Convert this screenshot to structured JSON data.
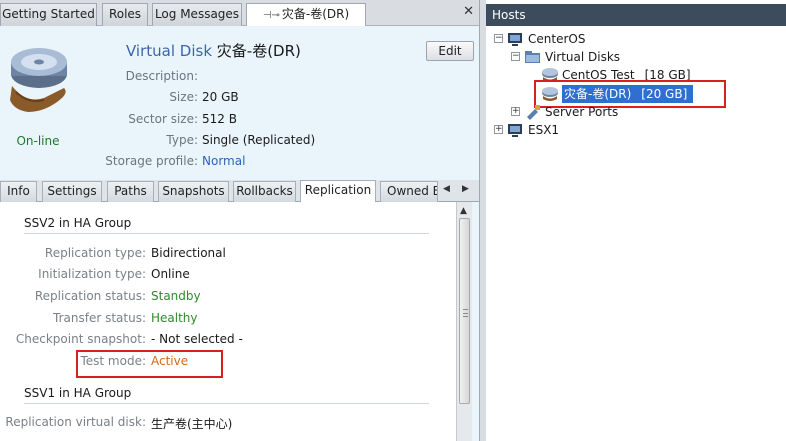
{
  "doc_tabs": [
    {
      "label": "Getting Started"
    },
    {
      "label": "Roles"
    },
    {
      "label": "Log Messages"
    },
    {
      "label": "灾备-卷(DR)",
      "active": true,
      "pinned": true
    }
  ],
  "header": {
    "kind": "Virtual Disk",
    "name": "灾备-卷(DR)",
    "edit_label": "Edit",
    "status": "On-line",
    "props": [
      {
        "label": "Description:",
        "value": ""
      },
      {
        "label": "Size:",
        "value": "20 GB"
      },
      {
        "label": "Sector size:",
        "value": "512 B"
      },
      {
        "label": "Type:",
        "value": "Single (Replicated)"
      },
      {
        "label": "Storage profile:",
        "value": "Normal"
      }
    ]
  },
  "sub_tabs": [
    {
      "label": "Info"
    },
    {
      "label": "Settings"
    },
    {
      "label": "Paths"
    },
    {
      "label": "Snapshots"
    },
    {
      "label": "Rollbacks"
    },
    {
      "label": "Replication",
      "active": true
    },
    {
      "label": "Owned B"
    }
  ],
  "replication": {
    "section1_title": "SSV2 in HA Group",
    "rows": [
      {
        "label": "Replication type:",
        "value": "Bidirectional"
      },
      {
        "label": "Initialization type:",
        "value": "Online"
      },
      {
        "label": "Replication status:",
        "value": "Standby"
      },
      {
        "label": "Transfer status:",
        "value": "Healthy"
      },
      {
        "label": "Checkpoint snapshot:",
        "value": "- Not selected -"
      },
      {
        "label": "Test mode:",
        "value": "Active"
      }
    ],
    "section2_title": "SSV1 in HA Group",
    "rows2": [
      {
        "label": "Replication virtual disk:",
        "value": "生产卷(主中心)"
      }
    ]
  },
  "hosts": {
    "title": "Hosts",
    "tree": [
      {
        "label": "CenterOS",
        "expand": "−"
      },
      {
        "label": "Virtual Disks",
        "expand": "−"
      },
      {
        "label": "CentOS Test",
        "size": "[18 GB]"
      },
      {
        "label": "灾备-卷(DR)",
        "size": "[20 GB]",
        "selected": true
      },
      {
        "label": "Server Ports",
        "expand": "+"
      },
      {
        "label": "ESX1",
        "expand": "+"
      }
    ]
  },
  "colors": {
    "accent": "#2f6fcf",
    "healthy": "#2e8b2e",
    "active": "#d26a1e",
    "highlight_box": "#d92020"
  }
}
